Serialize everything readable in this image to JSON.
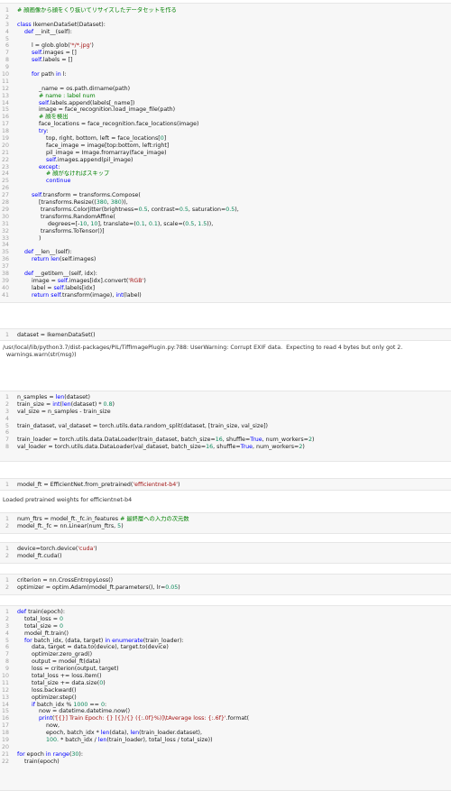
{
  "cells": [
    {
      "id": "cell1",
      "start": 1,
      "lines": [
        [
          [
            "cmt",
            "# 顔画像から顔をくり抜いてリサイズしたデータセットを作る"
          ]
        ],
        [],
        [
          [
            "kw",
            "class"
          ],
          [
            "plain",
            " IkemenDataSet(Dataset):"
          ]
        ],
        [
          [
            "plain",
            "    "
          ],
          [
            "kw",
            "def"
          ],
          [
            "plain",
            " __init__(self):"
          ]
        ],
        [],
        [
          [
            "plain",
            "        l = glob.glob("
          ],
          [
            "str",
            "'*/*.jpg'"
          ],
          [
            "plain",
            ")"
          ]
        ],
        [
          [
            "plain",
            "        "
          ],
          [
            "kw",
            "self"
          ],
          [
            "plain",
            ".images = []"
          ]
        ],
        [
          [
            "plain",
            "        "
          ],
          [
            "kw",
            "self"
          ],
          [
            "plain",
            ".labels = []"
          ]
        ],
        [],
        [
          [
            "plain",
            "        "
          ],
          [
            "kw",
            "for"
          ],
          [
            "plain",
            " path "
          ],
          [
            "kw",
            "in"
          ],
          [
            "plain",
            " l:"
          ]
        ],
        [],
        [
          [
            "plain",
            "            _name = os.path.dirname(path)"
          ]
        ],
        [
          [
            "plain",
            "            "
          ],
          [
            "cmt",
            "# name : label num"
          ]
        ],
        [
          [
            "plain",
            "            "
          ],
          [
            "kw",
            "self"
          ],
          [
            "plain",
            ".labels.append(labels[_name])"
          ]
        ],
        [
          [
            "plain",
            "            image = face_recognition.load_image_file(path)"
          ]
        ],
        [
          [
            "plain",
            "            "
          ],
          [
            "cmt",
            "# 顔を検出"
          ]
        ],
        [
          [
            "plain",
            "            face_locations = face_recognition.face_locations(image)"
          ]
        ],
        [
          [
            "plain",
            "            "
          ],
          [
            "kw",
            "try"
          ],
          [
            "plain",
            ":"
          ]
        ],
        [
          [
            "plain",
            "                top, right, bottom, left = face_locations["
          ],
          [
            "num",
            "0"
          ],
          [
            "plain",
            "]"
          ]
        ],
        [
          [
            "plain",
            "                face_image = image[top:bottom, left:right]"
          ]
        ],
        [
          [
            "plain",
            "                pil_image = Image.fromarray(face_image)"
          ]
        ],
        [
          [
            "plain",
            "                "
          ],
          [
            "kw",
            "self"
          ],
          [
            "plain",
            ".images.append(pil_image)"
          ]
        ],
        [
          [
            "plain",
            "            "
          ],
          [
            "kw",
            "except"
          ],
          [
            "plain",
            ":"
          ]
        ],
        [
          [
            "plain",
            "                "
          ],
          [
            "cmt",
            "# 顔がなければスキップ"
          ]
        ],
        [
          [
            "plain",
            "                "
          ],
          [
            "kw",
            "continue"
          ]
        ],
        [],
        [
          [
            "plain",
            "        "
          ],
          [
            "kw",
            "self"
          ],
          [
            "plain",
            ".transform = transforms.Compose("
          ]
        ],
        [
          [
            "plain",
            "            [transforms.Resize(("
          ],
          [
            "num",
            "380"
          ],
          [
            "plain",
            ", "
          ],
          [
            "num",
            "380"
          ],
          [
            "plain",
            ")),"
          ]
        ],
        [
          [
            "plain",
            "             transforms.ColorJitter(brightness="
          ],
          [
            "num",
            "0.5"
          ],
          [
            "plain",
            ", contrast="
          ],
          [
            "num",
            "0.5"
          ],
          [
            "plain",
            ", saturation="
          ],
          [
            "num",
            "0.5"
          ],
          [
            "plain",
            "),"
          ]
        ],
        [
          [
            "plain",
            "             transforms.RandomAffine("
          ]
        ],
        [
          [
            "plain",
            "                 degrees=[-"
          ],
          [
            "num",
            "10"
          ],
          [
            "plain",
            ", "
          ],
          [
            "num",
            "10"
          ],
          [
            "plain",
            "], translate=("
          ],
          [
            "num",
            "0.1"
          ],
          [
            "plain",
            ", "
          ],
          [
            "num",
            "0.1"
          ],
          [
            "plain",
            "), scale=("
          ],
          [
            "num",
            "0.5"
          ],
          [
            "plain",
            ", "
          ],
          [
            "num",
            "1.5"
          ],
          [
            "plain",
            ")),"
          ]
        ],
        [
          [
            "plain",
            "             transforms.ToTensor()]"
          ]
        ],
        [
          [
            "plain",
            "            )"
          ]
        ],
        [],
        [
          [
            "plain",
            "    "
          ],
          [
            "kw",
            "def"
          ],
          [
            "plain",
            " __len__(self):"
          ]
        ],
        [
          [
            "plain",
            "        "
          ],
          [
            "kw",
            "return"
          ],
          [
            "plain",
            " "
          ],
          [
            "kw",
            "len"
          ],
          [
            "plain",
            "(self.images)"
          ]
        ],
        [],
        [
          [
            "plain",
            "    "
          ],
          [
            "kw",
            "def"
          ],
          [
            "plain",
            " __getitem__(self, idx):"
          ]
        ],
        [
          [
            "plain",
            "        image = "
          ],
          [
            "kw",
            "self"
          ],
          [
            "plain",
            ".images[idx].convert("
          ],
          [
            "str",
            "'RGB'"
          ],
          [
            "plain",
            ")"
          ]
        ],
        [
          [
            "plain",
            "        label = "
          ],
          [
            "kw",
            "self"
          ],
          [
            "plain",
            ".labels[idx]"
          ]
        ],
        [
          [
            "plain",
            "        "
          ],
          [
            "kw",
            "return"
          ],
          [
            "plain",
            " "
          ],
          [
            "kw",
            "self"
          ],
          [
            "plain",
            ".transform(image), "
          ],
          [
            "kw",
            "int"
          ],
          [
            "plain",
            "(label)"
          ]
        ]
      ]
    },
    {
      "id": "cell2",
      "start": 1,
      "lines": [
        [
          [
            "plain",
            "dataset = IkemenDataSet()"
          ]
        ]
      ]
    },
    {
      "id": "cell3",
      "start": 1,
      "lines": [
        [
          [
            "plain",
            "n_samples = "
          ],
          [
            "kw",
            "len"
          ],
          [
            "plain",
            "(dataset)"
          ]
        ],
        [
          [
            "plain",
            "train_size = "
          ],
          [
            "kw",
            "int"
          ],
          [
            "plain",
            "("
          ],
          [
            "kw",
            "len"
          ],
          [
            "plain",
            "(dataset) * "
          ],
          [
            "num",
            "0.8"
          ],
          [
            "plain",
            ")"
          ]
        ],
        [
          [
            "plain",
            "val_size = n_samples - train_size"
          ]
        ],
        [],
        [
          [
            "plain",
            "train_dataset, val_dataset = torch.utils.data.random_split(dataset, [train_size, val_size])"
          ]
        ],
        [],
        [
          [
            "plain",
            "train_loader = torch.utils.data.DataLoader(train_dataset, batch_size="
          ],
          [
            "num",
            "16"
          ],
          [
            "plain",
            ", shuffle="
          ],
          [
            "kw",
            "True"
          ],
          [
            "plain",
            ", num_workers="
          ],
          [
            "num",
            "2"
          ],
          [
            "plain",
            ")"
          ]
        ],
        [
          [
            "plain",
            "val_loader = torch.utils.data.DataLoader(val_dataset, batch_size="
          ],
          [
            "num",
            "16"
          ],
          [
            "plain",
            ", shuffle="
          ],
          [
            "kw",
            "True"
          ],
          [
            "plain",
            ", num_workers="
          ],
          [
            "num",
            "2"
          ],
          [
            "plain",
            ")"
          ]
        ]
      ]
    },
    {
      "id": "cell4",
      "start": 1,
      "lines": [
        [
          [
            "plain",
            "model_ft = EfficientNet.from_pretrained("
          ],
          [
            "str",
            "'efficientnet-b4'"
          ],
          [
            "plain",
            ")"
          ]
        ]
      ]
    },
    {
      "id": "cell5",
      "start": 1,
      "lines": [
        [
          [
            "plain",
            "num_ftrs = model_ft._fc.in_features "
          ],
          [
            "cmt",
            "# 最終層への入力の次元数"
          ]
        ],
        [
          [
            "plain",
            "model_ft._fc = nn.Linear(num_ftrs, "
          ],
          [
            "num",
            "5"
          ],
          [
            "plain",
            ")"
          ]
        ]
      ]
    },
    {
      "id": "cell6",
      "start": 1,
      "lines": [
        [
          [
            "plain",
            "device=torch.device("
          ],
          [
            "str",
            "'cuda'"
          ],
          [
            "plain",
            ")"
          ]
        ],
        [
          [
            "plain",
            "model_ft.cuda()"
          ]
        ]
      ]
    },
    {
      "id": "cell7",
      "start": 1,
      "lines": [
        [
          [
            "plain",
            "criterion = nn.CrossEntropyLoss()"
          ]
        ],
        [
          [
            "plain",
            "optimizer = optim.Adam(model_ft.parameters(), lr="
          ],
          [
            "num",
            "0.05"
          ],
          [
            "plain",
            ")"
          ]
        ]
      ]
    },
    {
      "id": "cell8",
      "start": 1,
      "lines": [
        [
          [
            "kw",
            "def"
          ],
          [
            "plain",
            " train(epoch):"
          ]
        ],
        [
          [
            "plain",
            "    total_loss = "
          ],
          [
            "num",
            "0"
          ]
        ],
        [
          [
            "plain",
            "    total_size = "
          ],
          [
            "num",
            "0"
          ]
        ],
        [
          [
            "plain",
            "    model_ft.train()"
          ]
        ],
        [
          [
            "plain",
            "    "
          ],
          [
            "kw",
            "for"
          ],
          [
            "plain",
            " batch_idx, (data, target) "
          ],
          [
            "kw",
            "in"
          ],
          [
            "plain",
            " "
          ],
          [
            "kw",
            "enumerate"
          ],
          [
            "plain",
            "(train_loader):"
          ]
        ],
        [
          [
            "plain",
            "        data, target = data.to(device), target.to(device)"
          ]
        ],
        [
          [
            "plain",
            "        optimizer.zero_grad()"
          ]
        ],
        [
          [
            "plain",
            "        output = model_ft(data)"
          ]
        ],
        [
          [
            "plain",
            "        loss = criterion(output, target)"
          ]
        ],
        [
          [
            "plain",
            "        total_loss += loss.item()"
          ]
        ],
        [
          [
            "plain",
            "        total_size += data.size("
          ],
          [
            "num",
            "0"
          ],
          [
            "plain",
            ")"
          ]
        ],
        [
          [
            "plain",
            "        loss.backward()"
          ]
        ],
        [
          [
            "plain",
            "        optimizer.step()"
          ]
        ],
        [
          [
            "plain",
            "        "
          ],
          [
            "kw",
            "if"
          ],
          [
            "plain",
            " batch_idx % "
          ],
          [
            "num",
            "1000"
          ],
          [
            "plain",
            " == "
          ],
          [
            "num",
            "0"
          ],
          [
            "plain",
            ":"
          ]
        ],
        [
          [
            "plain",
            "            now = datetime.datetime.now()"
          ]
        ],
        [
          [
            "plain",
            "            "
          ],
          [
            "kw",
            "print"
          ],
          [
            "plain",
            "("
          ],
          [
            "str",
            "'[{}] Train Epoch: {} [{}/{} ({:.0f}%)]\\tAverage loss: {:.6f}'"
          ],
          [
            "plain",
            ".format("
          ]
        ],
        [
          [
            "plain",
            "                now,"
          ]
        ],
        [
          [
            "plain",
            "                epoch, batch_idx * "
          ],
          [
            "kw",
            "len"
          ],
          [
            "plain",
            "(data), "
          ],
          [
            "kw",
            "len"
          ],
          [
            "plain",
            "(train_loader.dataset),"
          ]
        ],
        [
          [
            "plain",
            "                "
          ],
          [
            "num",
            "100."
          ],
          [
            "plain",
            " * batch_idx / "
          ],
          [
            "kw",
            "len"
          ],
          [
            "plain",
            "(train_loader), total_loss / total_size))"
          ]
        ],
        [],
        [
          [
            "kw",
            "for"
          ],
          [
            "plain",
            " epoch "
          ],
          [
            "kw",
            "in"
          ],
          [
            "plain",
            " "
          ],
          [
            "kw",
            "range"
          ],
          [
            "plain",
            "("
          ],
          [
            "num",
            "30"
          ],
          [
            "plain",
            "):"
          ]
        ],
        [
          [
            "plain",
            "    train(epoch)"
          ]
        ]
      ]
    }
  ],
  "outputs": {
    "warning": "/usr/local/lib/python3.7/dist-packages/PIL/TiffImagePlugin.py:788: UserWarning: Corrupt EXIF data.  Expecting to read 4 bytes but only got 2.\n  warnings.warn(str(msg))",
    "pretrained": "Loaded pretrained weights for efficientnet-b4"
  },
  "theme": {
    "keyword": "#0000ff",
    "comment": "#008000",
    "string": "#a31515",
    "number": "#098658",
    "line_number": "#a0a0a0",
    "cell_background": "#f7f7f7"
  }
}
